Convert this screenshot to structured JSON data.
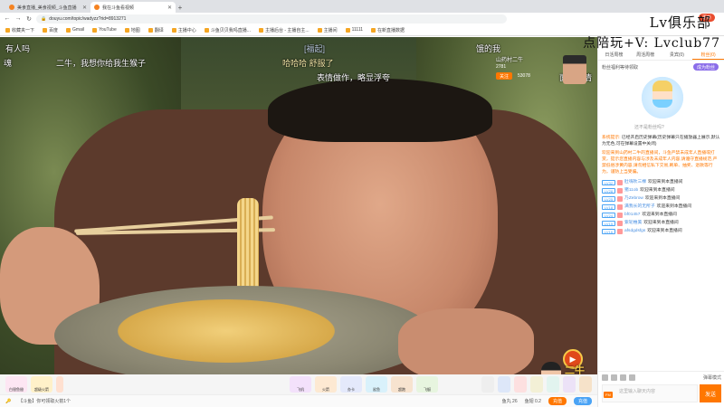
{
  "browser": {
    "tabs": [
      {
        "title": "美食直播_美食视频_斗鱼直播",
        "active": false
      },
      {
        "title": "我在斗鱼看视频",
        "active": true
      }
    ],
    "url": "douyu.com/topic/wadyzz?rid=8913271",
    "update_label": "更新",
    "bookmarks": [
      "收藏夹一下",
      "百度",
      "Gmail",
      "YouTube",
      "地图",
      "翻译",
      "主播中心",
      "斗鱼贝贝我吗直播...",
      "主播后台 - 主播自主...",
      "主播间",
      "11111",
      "在新直播数据"
    ]
  },
  "overlay": {
    "watermark_line1": "Lv俱乐部",
    "watermark_line2": "点陪玩+V: Lvclub77"
  },
  "video": {
    "danmu": [
      "有人吗",
      "二牛，我想你给我生猴子",
      "[福起]",
      "哈哈哈 舒服了",
      "表情做作，略显浮夸",
      "饿的我",
      "面部表情",
      "魂"
    ],
    "anchor": {
      "name": "山药村二牛",
      "heat": "2781",
      "follow_label": "关注",
      "fans": "53078"
    },
    "logo_text": "二牛"
  },
  "toolbar": {
    "gifts": [
      "白银鱼翅",
      "超级火箭",
      "飞机",
      "火箭",
      "办卡",
      "鲨鱼",
      "超跑",
      "飞艇"
    ],
    "bottom_left": "【斗鱼】你可领取火箭1个",
    "bottom_right": [
      "鱼丸 26",
      "鱼翅 0.2",
      "充值",
      "充值"
    ]
  },
  "sidebar": {
    "tabs": [
      "日活周榜",
      "周活周榜",
      "贵宾(0)",
      "粉丝(0)"
    ],
    "promo_title": "粉丝福利等待领取",
    "promo_button": "成为粉丝",
    "promo_caption": "还不是粉丝吗?",
    "sys_label": "系统提示:",
    "sys_msg1": "已经开启历史弹幕(历史弹幕只在播放器上展示,默认为无色,可在弹幕设置中关闭)",
    "sys_msg2": "欢迎来到山药村二牛的直播间，斗鱼严禁未成年人直播或打赏，提示您直播内容与涉及未成年人内容,请遵守直播规范,严禁低俗涉黄内容,请勿相信私下交易,刷单、抽奖、退款等行为，谨防上当受骗。",
    "messages": [
      {
        "lv": "LV32",
        "user": "肚嗨吹三棵",
        "text": "欢迎来到本直播间"
      },
      {
        "lv": "LV28",
        "user": "猪11ob",
        "text": "欢迎来到本直播间"
      },
      {
        "lv": "LV25",
        "user": "乃Zebrow",
        "text": "欢迎来到本直播间"
      },
      {
        "lv": "LV18",
        "user": "满我长的无所子",
        "text": "欢迎来到本直播间"
      },
      {
        "lv": "LV24",
        "user": "bf01457",
        "text": "欢迎来到本直播间"
      },
      {
        "lv": "LV15",
        "user": "紫轮椎美",
        "text": "欢迎来到本直播间"
      },
      {
        "lv": "LV16",
        "user": "afsdgdsfgs",
        "text": "欢迎来到本直播间"
      }
    ],
    "input_placeholder": "这里输入聊天内容",
    "send_label": "发送",
    "check_label": "弹幕模式",
    "badge_label": "FM"
  }
}
